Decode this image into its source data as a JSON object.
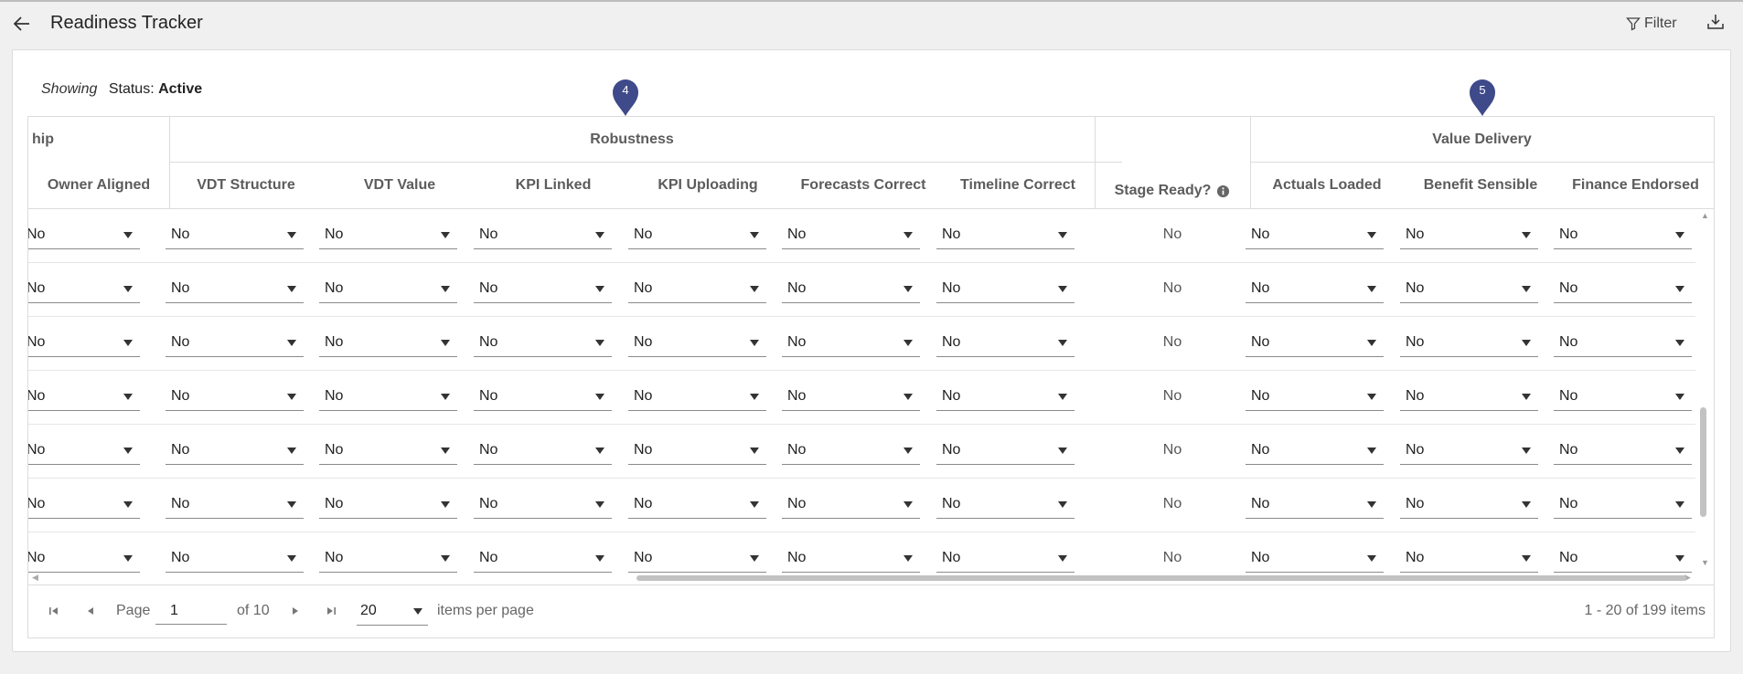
{
  "header": {
    "title": "Readiness Tracker",
    "filter_label": "Filter",
    "back_icon": "arrow-left-icon",
    "filter_icon": "funnel-icon",
    "export_icon": "download-icon"
  },
  "showing": {
    "prefix": "Showing",
    "status_label": "Status:",
    "status_value": "Active"
  },
  "groups": {
    "ownership_partial": "hip",
    "robustness": "Robustness",
    "value_delivery": "Value Delivery"
  },
  "columns": {
    "owner_aligned": "Owner Aligned",
    "vdt_structure": "VDT Structure",
    "vdt_value": "VDT Value",
    "kpi_linked": "KPI Linked",
    "kpi_uploading": "KPI Uploading",
    "forecasts_correct": "Forecasts Correct",
    "timeline_correct": "Timeline Correct",
    "stage_ready": "Stage Ready?",
    "actuals_loaded": "Actuals Loaded",
    "benefit_sensible": "Benefit Sensible",
    "finance_endorsed": "Finance Endorsed"
  },
  "markers": {
    "robustness": "4",
    "value_delivery": "5"
  },
  "rows": [
    [
      "No",
      "No",
      "No",
      "No",
      "No",
      "No",
      "No",
      "No",
      "No",
      "No",
      "No"
    ],
    [
      "No",
      "No",
      "No",
      "No",
      "No",
      "No",
      "No",
      "No",
      "No",
      "No",
      "No"
    ],
    [
      "No",
      "No",
      "No",
      "No",
      "No",
      "No",
      "No",
      "No",
      "No",
      "No",
      "No"
    ],
    [
      "No",
      "No",
      "No",
      "No",
      "No",
      "No",
      "No",
      "No",
      "No",
      "No",
      "No"
    ],
    [
      "No",
      "No",
      "No",
      "No",
      "No",
      "No",
      "No",
      "No",
      "No",
      "No",
      "No"
    ],
    [
      "No",
      "No",
      "No",
      "No",
      "No",
      "No",
      "No",
      "No",
      "No",
      "No",
      "No"
    ],
    [
      "No",
      "No",
      "No",
      "No",
      "No",
      "No",
      "No",
      "No",
      "No",
      "No",
      "No"
    ]
  ],
  "pager": {
    "page_label": "Page",
    "page_value": "1",
    "of_label": "of 10",
    "per_page_value": "20",
    "per_page_label": "items per page",
    "summary": "1 - 20 of 199 items"
  },
  "colors": {
    "marker": "#3f4a8a",
    "info_icon": "#666666"
  }
}
